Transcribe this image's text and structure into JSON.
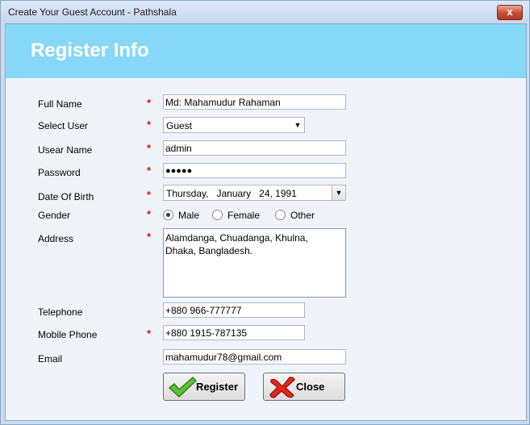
{
  "window": {
    "title": "Create Your Guest Account - Pathshala",
    "close_label": "x"
  },
  "banner": {
    "title": "Register Info"
  },
  "form": {
    "full_name_label": "Full Name",
    "full_name_value": "Md: Mahamudur Rahaman",
    "select_user_label": "Select User",
    "select_user_value": "Guest",
    "user_name_label": "Usear Name",
    "user_name_value": "admin",
    "password_label": "Password",
    "password_value": "●●●●●",
    "dob_label": "Date Of Birth",
    "dob_value": "Thursday,   January   24, 1991",
    "gender_label": "Gender",
    "gender_options": [
      "Male",
      "Female",
      "Other"
    ],
    "gender_selected": "Male",
    "address_label": "Address",
    "address_value": "Alamdanga, Chuadanga, Khulna,\nDhaka, Bangladesh.",
    "telephone_label": "Telephone",
    "telephone_value": "+880 966-777777",
    "mobile_label": "Mobile Phone",
    "mobile_value": "+880 1915-787135",
    "email_label": "Email",
    "email_value": "mahamudur78@gmail.com",
    "required_mark": "*"
  },
  "buttons": {
    "register": "Register",
    "close": "Close"
  },
  "icons": {
    "register_icon": "checkmark-icon",
    "close_icon": "red-x-icon"
  },
  "colors": {
    "banner": "#87d8f8",
    "required": "#e01010"
  }
}
